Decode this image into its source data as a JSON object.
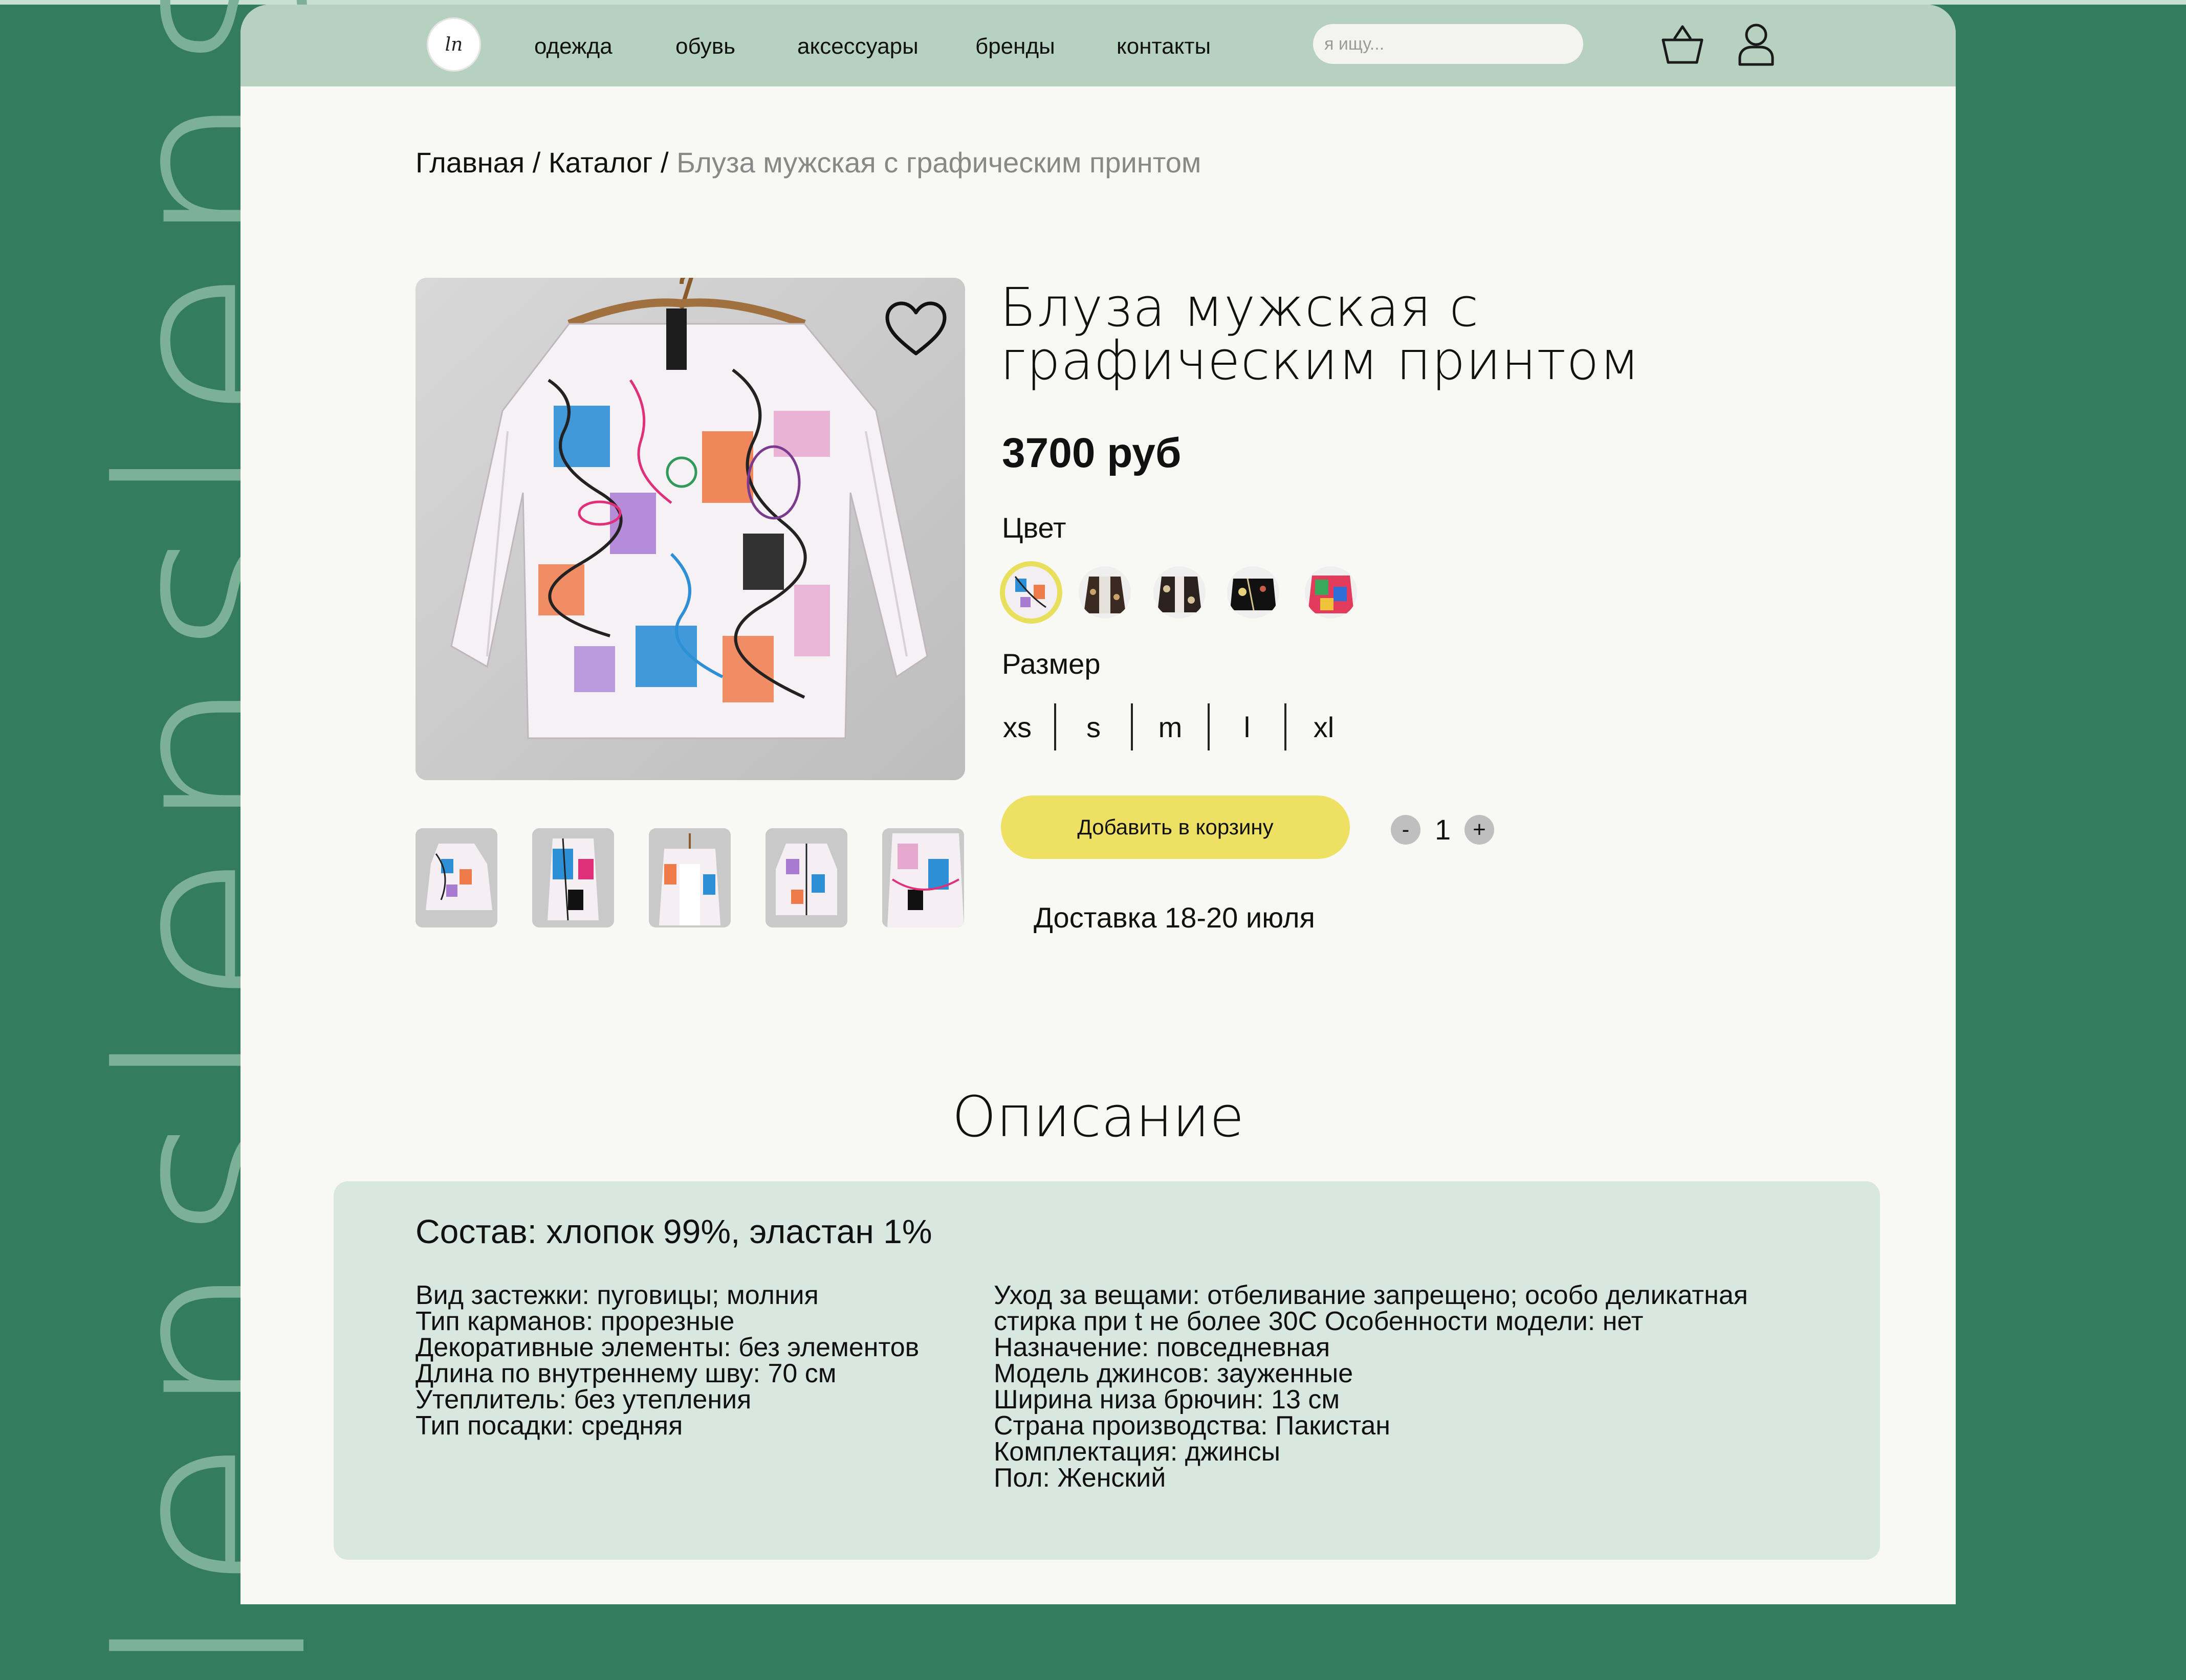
{
  "brand": {
    "side_word": "lenslenslens",
    "logo_text": "ln"
  },
  "nav": {
    "items": [
      "одежда",
      "обувь",
      "аксессуары",
      "бренды",
      "контакты"
    ],
    "search_placeholder": "я ищу..."
  },
  "breadcrumb": {
    "items": [
      "Главная",
      "Каталог"
    ],
    "separator": " / ",
    "current": "Блуза мужская с графическим принтом"
  },
  "product": {
    "title": "Блуза мужская с графическим принтом",
    "price": "3700 руб",
    "color_label": "Цвет",
    "size_label": "Размер",
    "sizes": [
      "xs",
      "s",
      "m",
      "l",
      "xl"
    ],
    "add_to_cart": "Добавить в корзину",
    "qty_minus": "-",
    "qty_plus": "+",
    "quantity": "1",
    "delivery": "Доставка 18-20 июля"
  },
  "description": {
    "title": "Описание",
    "composition": "Состав: хлопок 99%, эластан 1%",
    "left": [
      "Вид застежки: пуговицы; молния",
      "Тип карманов: прорезные",
      "Декоративные элементы: без элементов",
      "Длина по внутреннему шву: 70 см",
      "Утеплитель: без утепления",
      "Тип посадки: средняя"
    ],
    "right": [
      "Уход за вещами: отбеливание запрещено; особо деликатная",
      "стирка при t не более 30С Особенности модели: нет",
      "Назначение: повседневная",
      "Модель джинсов: зауженные",
      "Ширина низа брючин: 13 см",
      "Страна производства: Пакистан",
      "Комплектация: джинсы",
      "Пол: Женский"
    ]
  },
  "colors": {
    "page_bg": "#337d5e",
    "header_bg": "#b6d1c0",
    "button": "#ede063",
    "desc_box": "#d8e7df"
  }
}
